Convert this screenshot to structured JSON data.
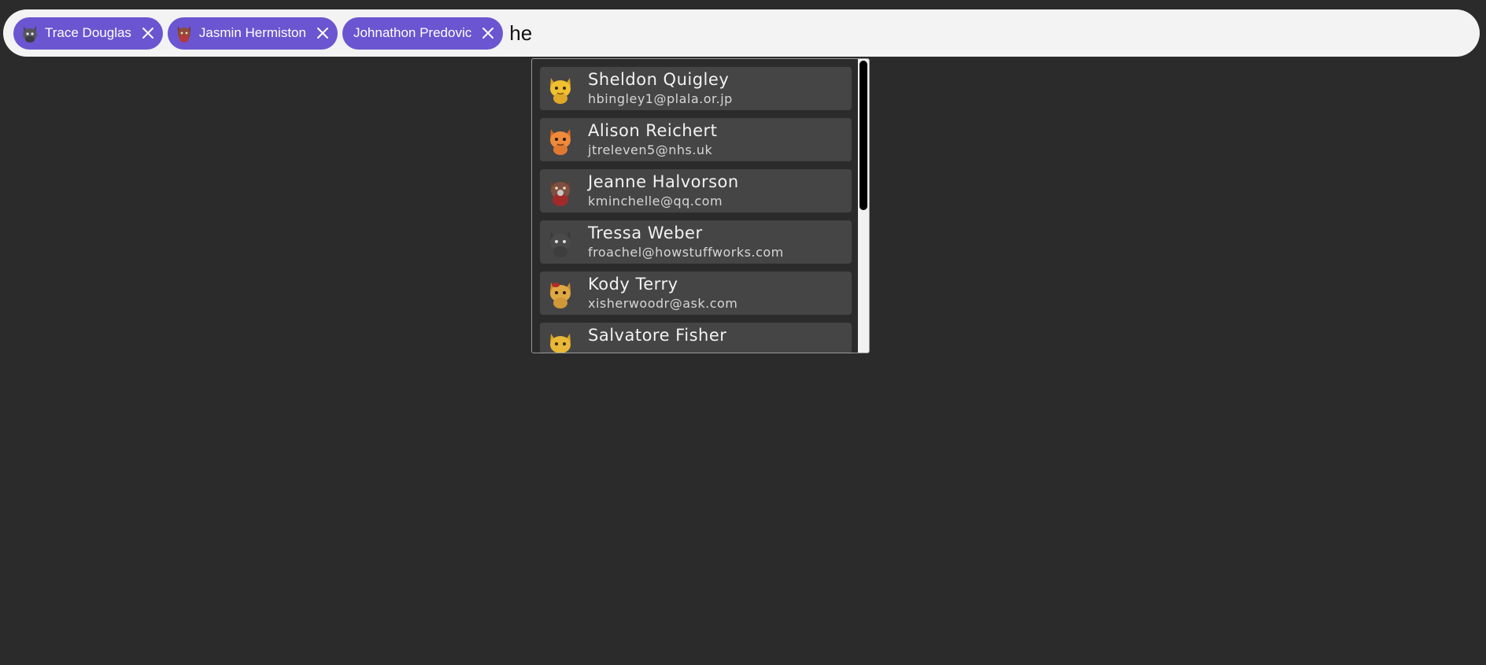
{
  "colors": {
    "background": "#2b2b2b",
    "input_background": "#f3f3f3",
    "chip_background": "#6b55d0",
    "option_background": "#454545"
  },
  "token_input": {
    "chips": [
      {
        "label": "Trace Douglas",
        "avatar_icon": "gray-cat-avatar-icon",
        "remove_icon": "close-icon"
      },
      {
        "label": "Jasmin Hermiston",
        "avatar_icon": "red-cat-avatar-icon",
        "remove_icon": "close-icon"
      },
      {
        "label": "Johnathon Predovic",
        "avatar_icon": "none",
        "remove_icon": "close-icon"
      }
    ],
    "query": "he"
  },
  "dropdown": {
    "options": [
      {
        "name": "Sheldon Quigley",
        "email": "hbingley1@plala.or.jp",
        "avatar_icon": "yellow-cat-avatar-icon"
      },
      {
        "name": "Alison Reichert",
        "email": "jtreleven5@nhs.uk",
        "avatar_icon": "orange-cat-avatar-icon"
      },
      {
        "name": "Jeanne Halvorson",
        "email": "kminchelle@qq.com",
        "avatar_icon": "brown-cat-avatar-icon"
      },
      {
        "name": "Tressa Weber",
        "email": "froachel@howstuffworks.com",
        "avatar_icon": "dark-cat-avatar-icon"
      },
      {
        "name": "Kody Terry",
        "email": "xisherwoodr@ask.com",
        "avatar_icon": "tan-cat-avatar-icon"
      },
      {
        "name": "Salvatore Fisher",
        "email": "",
        "avatar_icon": "yellow-cat-avatar-icon"
      }
    ]
  }
}
